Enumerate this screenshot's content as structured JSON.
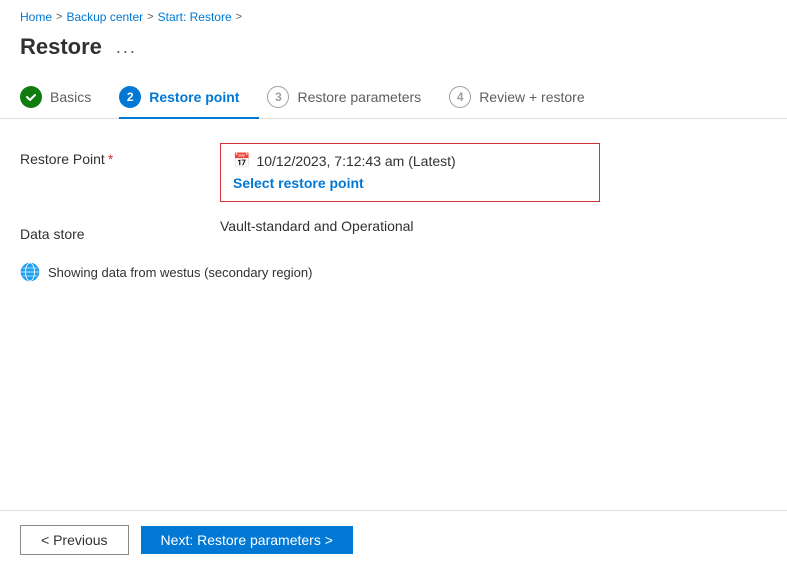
{
  "breadcrumb": {
    "items": [
      {
        "label": "Home",
        "link": true
      },
      {
        "label": "Backup center",
        "link": true
      },
      {
        "label": "Start: Restore",
        "link": true
      }
    ],
    "separator": ">"
  },
  "page": {
    "title": "Restore",
    "menu_label": "..."
  },
  "tabs": [
    {
      "id": "basics",
      "label": "Basics",
      "number": "1",
      "state": "completed"
    },
    {
      "id": "restore-point",
      "label": "Restore point",
      "number": "2",
      "state": "active"
    },
    {
      "id": "restore-parameters",
      "label": "Restore parameters",
      "number": "3",
      "state": "inactive"
    },
    {
      "id": "review-restore",
      "label": "Review + restore",
      "number": "4",
      "state": "inactive"
    }
  ],
  "form": {
    "restore_point_label": "Restore Point",
    "restore_point_required": "*",
    "restore_point_value": "10/12/2023, 7:12:43 am (Latest)",
    "select_link_label": "Select restore point",
    "data_store_label": "Data store",
    "data_store_value": "Vault-standard and Operational",
    "region_info": "Showing data from westus (secondary region)"
  },
  "footer": {
    "previous_label": "< Previous",
    "next_label": "Next: Restore parameters >"
  }
}
